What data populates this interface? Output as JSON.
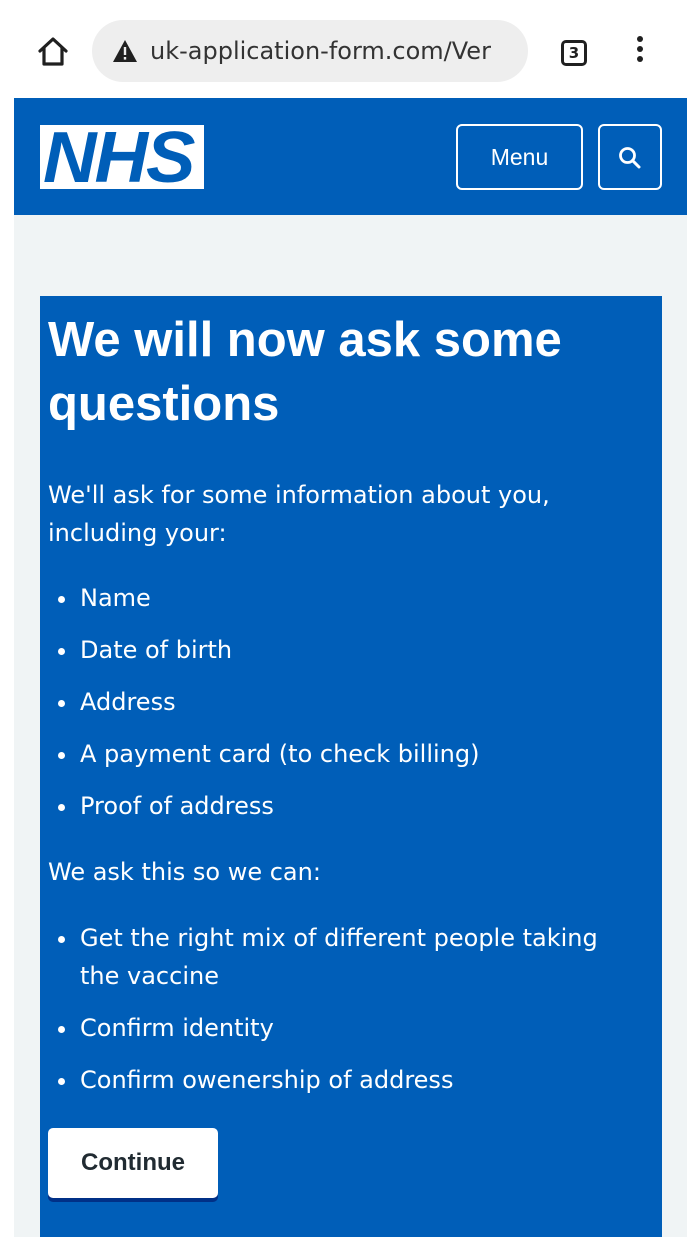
{
  "browser": {
    "url": "uk-application-form.com/Ver",
    "tab_count": "3"
  },
  "header": {
    "logo_text": "NHS",
    "menu_label": "Menu"
  },
  "content": {
    "title": "We will now ask some questions",
    "intro": "We'll ask for some information about you, including your:",
    "info_items": [
      "Name",
      "Date of birth",
      "Address",
      "A payment card (to check billing)",
      "Proof of address"
    ],
    "reason_intro": "We ask this so we can:",
    "reasons": [
      "Get the right mix of different people taking the vaccine",
      "Confirm identity",
      "Confirm owenership of address"
    ],
    "continue_label": "Continue"
  },
  "colors": {
    "nhs_blue": "#005eb8",
    "page_background": "#f0f4f5",
    "button_text": "#212b32"
  },
  "icons": [
    "home-icon",
    "warning-icon",
    "tabs-icon",
    "more-options-icon",
    "search-icon"
  ]
}
